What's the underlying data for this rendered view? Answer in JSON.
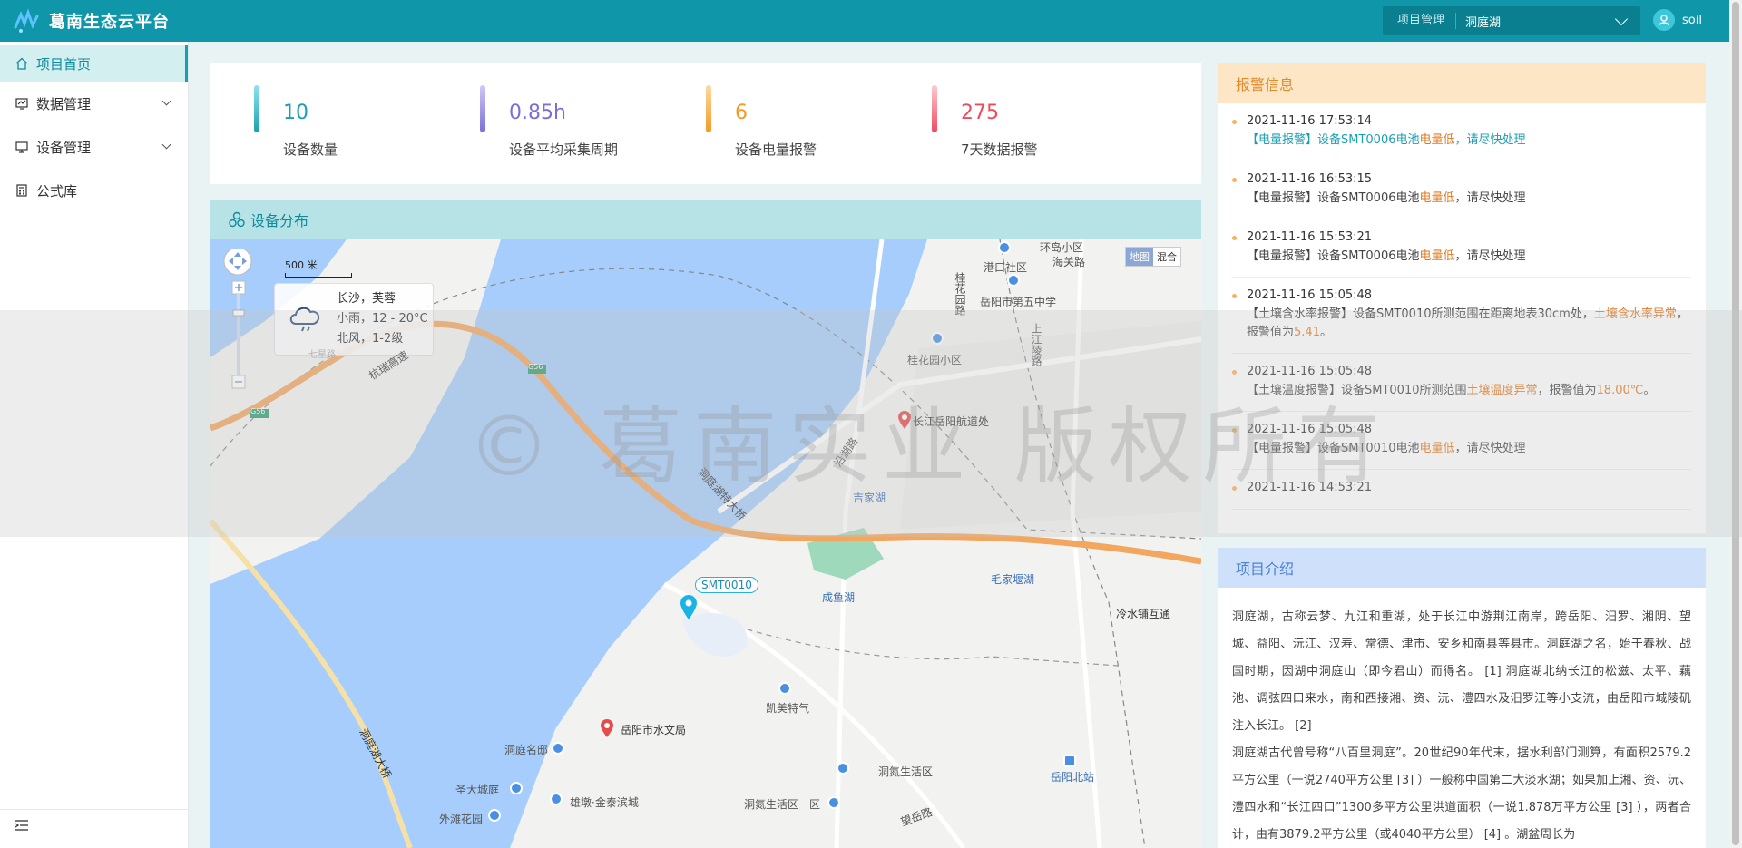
{
  "header": {
    "app_title": "葛南生态云平台",
    "project_label": "项目管理",
    "project_value": "洞庭湖",
    "user_name": "soil"
  },
  "sidebar": {
    "items": [
      {
        "label": "项目首页",
        "icon": "home-icon"
      },
      {
        "label": "数据管理",
        "icon": "data-icon"
      },
      {
        "label": "设备管理",
        "icon": "monitor-icon"
      },
      {
        "label": "公式库",
        "icon": "formula-icon"
      }
    ]
  },
  "stats": [
    {
      "value": "10",
      "label": "设备数量",
      "color": "#1aa0b3"
    },
    {
      "value": "0.85h",
      "label": "设备平均采集周期",
      "color": "#7a6fd8"
    },
    {
      "value": "6",
      "label": "设备电量报警",
      "color": "#f39a26"
    },
    {
      "value": "275",
      "label": "7天数据报警",
      "color": "#ef4b5e"
    }
  ],
  "map": {
    "title": "设备分布",
    "scale_label": "500 米",
    "map_type_options": [
      "地图",
      "混合"
    ],
    "weather": {
      "city": "长沙，芙蓉",
      "condition": "小雨，12 - 20°C",
      "wind": "北风，1-2级"
    },
    "device_tag": "SMT0010",
    "labels": [
      "环岛小区",
      "海关路",
      "港口社区",
      "桂花园路",
      "岳阳市第五中学",
      "上江陵路",
      "桂花园小区",
      "长江岳阳航道处",
      "杭瑞高速",
      "G56",
      "G56",
      "七星路",
      "沿湖路",
      "吉家湖",
      "洞庭湖特大桥",
      "毛家堰湖",
      "成鱼湖",
      "冷水铺互通",
      "凯美特气",
      "岳阳市水文局",
      "洞庭名邸",
      "洞氮生活区",
      "岳阳北站",
      "圣大城庭",
      "雄墩·金泰滨城",
      "外滩花园",
      "洞氮生活区一区",
      "望岳路",
      "洞庭湖大桥"
    ]
  },
  "alarm": {
    "title": "报警信息",
    "items": [
      {
        "time": "2021-11-16 17:53:14",
        "prefix": "【电量报警】设备SMT0006电池",
        "hl": "电量低",
        "suffix": "，请尽快处理"
      },
      {
        "time": "2021-11-16 16:53:15",
        "prefix": "【电量报警】设备SMT0006电池",
        "hl": "电量低",
        "suffix": "，请尽快处理"
      },
      {
        "time": "2021-11-16 15:53:21",
        "prefix": "【电量报警】设备SMT0006电池",
        "hl": "电量低",
        "suffix": "，请尽快处理"
      },
      {
        "time": "2021-11-16 15:05:48",
        "prefix": "【土壤含水率报警】设备SMT0010所测范围在距离地表30cm处，",
        "hl": "土壤含水率异常",
        "suffix": "，报警值为",
        "hl2": "5.41",
        "suffix2": "。"
      },
      {
        "time": "2021-11-16 15:05:48",
        "prefix": "【土壤温度报警】设备SMT0010所测范围",
        "hl": "土壤温度异常",
        "suffix": "，报警值为",
        "hl2": "18.00℃",
        "suffix2": "。"
      },
      {
        "time": "2021-11-16 15:05:48",
        "prefix": "【电量报警】设备SMT0010电池",
        "hl": "电量低",
        "suffix": "，请尽快处理"
      },
      {
        "time": "2021-11-16 14:53:21",
        "prefix": "",
        "hl": "",
        "suffix": ""
      }
    ]
  },
  "intro": {
    "title": "项目介绍",
    "paragraphs": [
      "洞庭湖，古称云梦、九江和重湖，处于长江中游荆江南岸，跨岳阳、汨罗、湘阴、望城、益阳、沅江、汉寿、常德、津市、安乡和南县等县市。洞庭湖之名，始于春秋、战国时期，因湖中洞庭山（即今君山）而得名。 [1]  洞庭湖北纳长江的松滋、太平、藕池、调弦四口来水，南和西接湘、资、沅、澧四水及汨罗江等小支流，由岳阳市城陵矶注入长江。 [2]",
      "洞庭湖古代曾号称“八百里洞庭”。20世纪90年代末，据水利部门测算，有面积2579.2平方公里（一说2740平方公里 [3] ）一般称中国第二大淡水湖；如果加上湘、资、沅、澧四水和“长江四口”1300多平方公里洪道面积（一说1.878万平方公里 [3] ），两者合计，由有3879.2平方公里（或4040平方公里） [4] 。湖盆周长为"
    ]
  },
  "watermark": "© 葛南实业 版权所有",
  "colors": {
    "topbar": "#0f97a9",
    "accent": "#11a3b5",
    "alarm_header": "#fde6c6",
    "intro_header": "#cfe0fb",
    "highlight": "#e27a1e",
    "water": "#a6cdfb"
  }
}
